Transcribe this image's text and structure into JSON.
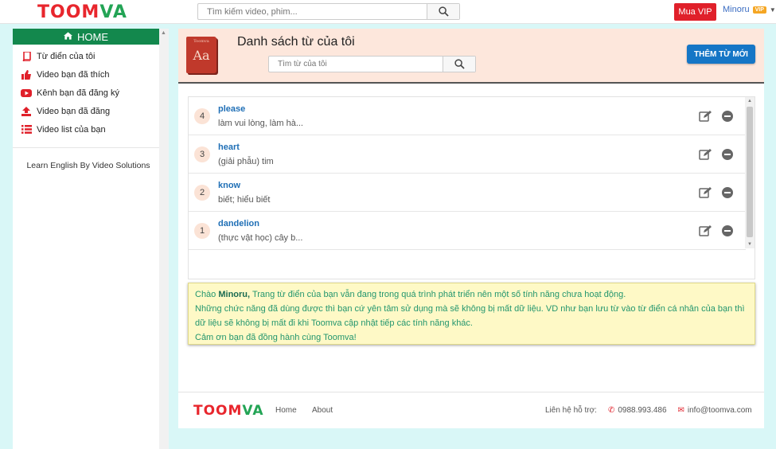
{
  "brand": {
    "logo_main": "TOOM",
    "logo_accent": "VA",
    "logo_tail": ""
  },
  "topbar": {
    "search_placeholder": "Tìm kiếm video, phim...",
    "vip_button": "Mua VIP",
    "username": "Minoru",
    "vip_badge": "VIP"
  },
  "sidebar": {
    "home_label": "HOME",
    "items": [
      {
        "label": "Từ điển của tôi",
        "icon": "book-icon"
      },
      {
        "label": "Video bạn đã thích",
        "icon": "thumbs-up-icon"
      },
      {
        "label": "Kênh bạn đã đăng ký",
        "icon": "youtube-icon"
      },
      {
        "label": "Video bạn đã đăng",
        "icon": "upload-icon"
      },
      {
        "label": "Video list của bạn",
        "icon": "list-icon"
      }
    ],
    "footer_text": "Learn English By Video Solutions"
  },
  "header": {
    "book_title": "Toomva",
    "book_text": "Aa",
    "title": "Danh sách từ của tôi",
    "search_placeholder": "Tìm từ của tôi",
    "add_button": "THÊM TỪ MỚI"
  },
  "words": [
    {
      "num": "4",
      "term": "please",
      "meaning": "làm vui lòng, làm hà..."
    },
    {
      "num": "3",
      "term": "heart",
      "meaning": "(giải phẫu) tim"
    },
    {
      "num": "2",
      "term": "know",
      "meaning": "biết; hiểu biết"
    },
    {
      "num": "1",
      "term": "dandelion",
      "meaning": "(thực vật học) cây b..."
    }
  ],
  "notice": {
    "greeting": "Chào",
    "name": "Minoru,",
    "line1_rest": "Trang từ điển của bạn vẫn đang trong quá trình phát triển nên một số tính năng chưa hoạt động.",
    "line2": "Những chức năng đã dùng được thì bạn cứ yên tâm sử dụng mà sẽ không bị mất dữ liệu. VD như bạn lưu từ vào từ điển cá nhân của bạn thì dữ liệu sẽ không bị mất đi khi Toomva cập nhật tiếp các tính năng khác.",
    "line3": "Cảm ơn bạn đã đồng hành cùng Toomva!"
  },
  "footer": {
    "home_link": "Home",
    "about_link": "About",
    "contact_label": "Liên hệ hỗ trợ:",
    "phone": "0988.993.486",
    "email": "info@toomva.com"
  },
  "colors": {
    "brand_red": "#e8262d",
    "brand_green": "#23a455",
    "home_green": "#13884d",
    "button_blue": "#1576c6",
    "header_bg": "#fde7dc",
    "notice_bg": "#fef9c6"
  }
}
